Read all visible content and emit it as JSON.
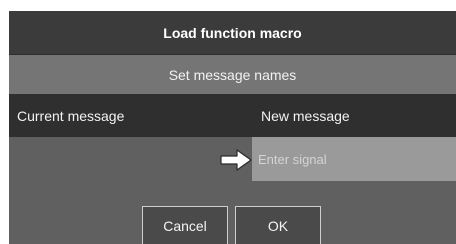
{
  "dialog": {
    "title": "Load function macro",
    "subtitle": "Set message names",
    "columns": {
      "current": "Current message",
      "new": "New message"
    },
    "signal_input": {
      "placeholder": "Enter signal",
      "value": ""
    },
    "arrow_icon": "arrow-right-icon",
    "buttons": {
      "cancel": "Cancel",
      "ok": "OK"
    }
  },
  "colors": {
    "dialog_bg": "#606060",
    "title_bg": "#3b3b3b",
    "subtitle_bg": "#757575",
    "header_bg": "#2f2f2f",
    "input_bg": "#9a9a9a",
    "button_bg": "#4a4a4a"
  }
}
